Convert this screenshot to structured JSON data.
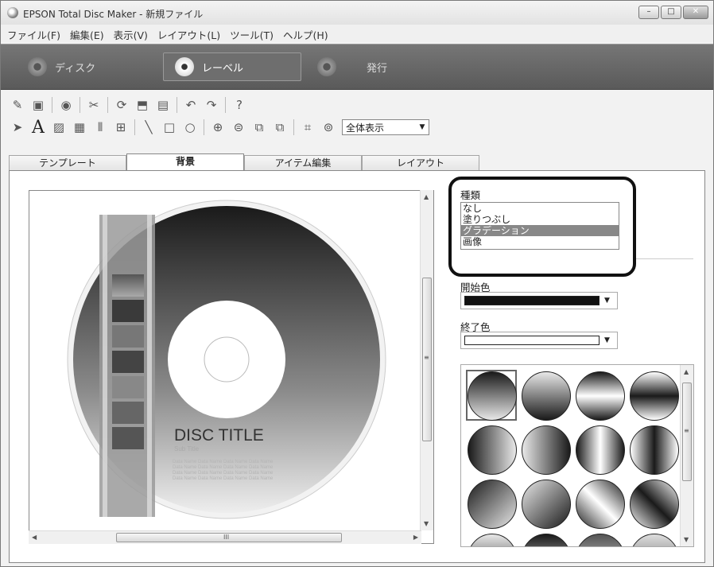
{
  "window": {
    "title": "EPSON Total Disc Maker - 新規ファイル"
  },
  "menu": [
    "ファイル(F)",
    "編集(E)",
    "表示(V)",
    "レイアウト(L)",
    "ツール(T)",
    "ヘルプ(H)"
  ],
  "modes": {
    "disc": "ディスク",
    "label": "レーベル",
    "publish": "発行"
  },
  "toolbar": {
    "zoom_value": "全体表示"
  },
  "tabs": [
    "テンプレート",
    "背景",
    "アイテム編集",
    "レイアウト"
  ],
  "background_panel": {
    "type_label": "種類",
    "type_options": [
      "なし",
      "塗りつぶし",
      "グラデーション",
      "画像"
    ],
    "selected_type": "グラデーション",
    "start_color_label": "開始色",
    "start_color": "#111111",
    "end_color_label": "終了色",
    "end_color": "#ffffff"
  },
  "disc": {
    "title": "DISC TITLE",
    "subtitle": "Sub Title",
    "data_lines": [
      "Data Name Data Name Data Name Data Name",
      "Data Name Data Name Data Name Data Name",
      "Data Name Data Name Data Name Data Name",
      "Data Name Data Name Data Name Data Name"
    ]
  },
  "scrollbar": {
    "h_grip": "III",
    "v_grip": "≡",
    "g_grip": "≡"
  },
  "colors": {
    "accent": "#111111",
    "mode_bar": "#666666"
  }
}
